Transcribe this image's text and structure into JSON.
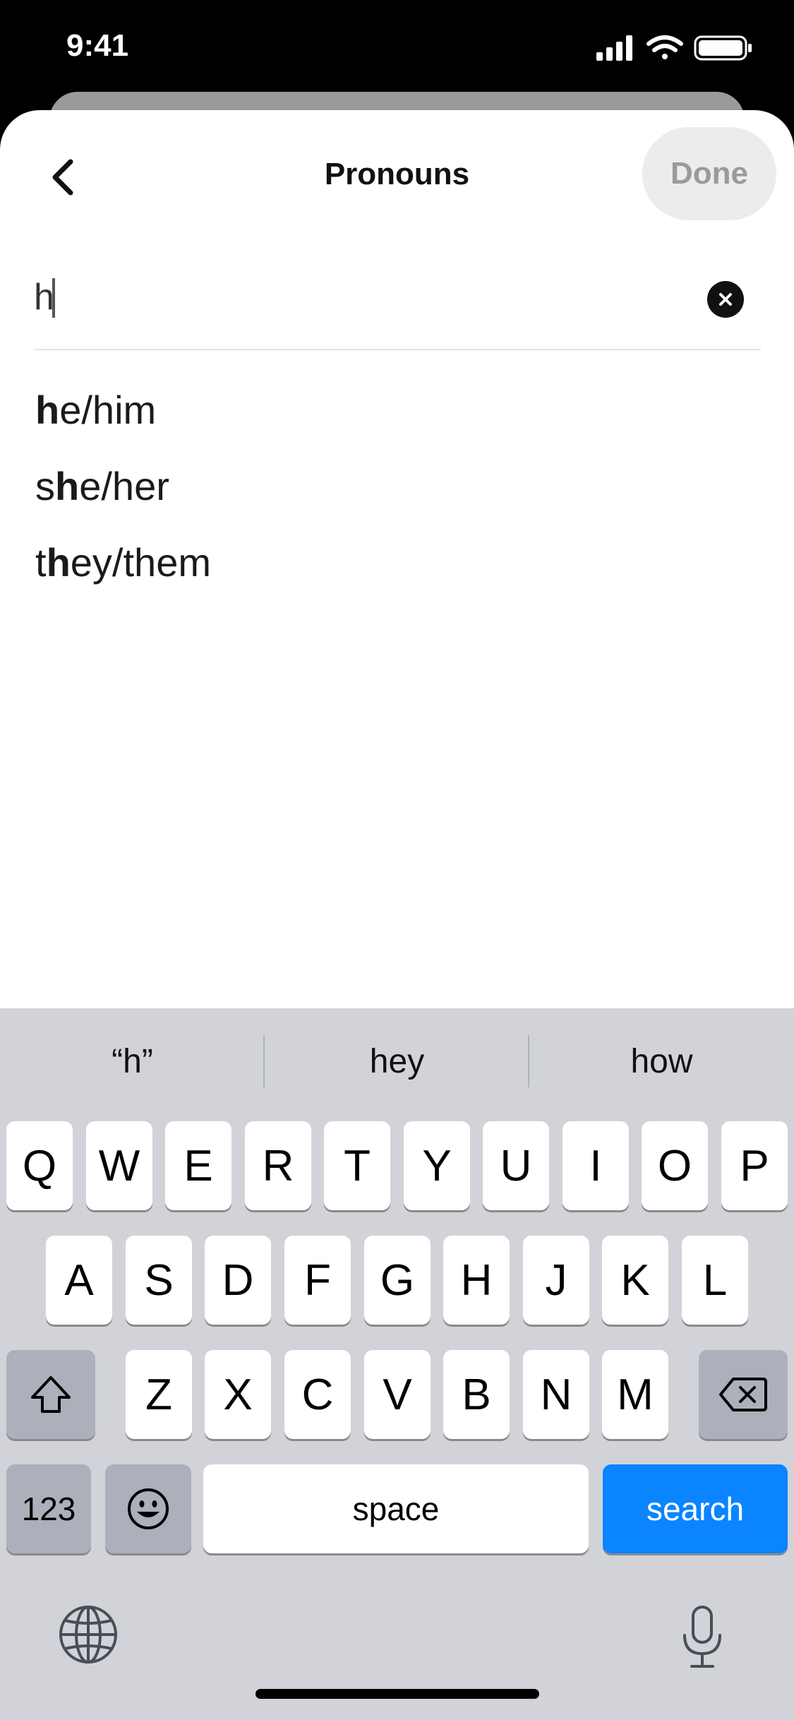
{
  "status_bar": {
    "time": "9:41"
  },
  "nav": {
    "title": "Pronouns",
    "done_label": "Done"
  },
  "search": {
    "value": "h"
  },
  "suggestions": [
    {
      "bold": "h",
      "rest": "e/him",
      "prefix": ""
    },
    {
      "prefix": "s",
      "bold": "h",
      "rest": "e/her"
    },
    {
      "prefix": "t",
      "bold": "h",
      "rest": "ey/them"
    }
  ],
  "keyboard": {
    "predictions": [
      "“h”",
      "hey",
      "how"
    ],
    "row1": [
      "Q",
      "W",
      "E",
      "R",
      "T",
      "Y",
      "U",
      "I",
      "O",
      "P"
    ],
    "row2": [
      "A",
      "S",
      "D",
      "F",
      "G",
      "H",
      "J",
      "K",
      "L"
    ],
    "row3": [
      "Z",
      "X",
      "C",
      "V",
      "B",
      "N",
      "M"
    ],
    "numbers_label": "123",
    "space_label": "space",
    "search_label": "search"
  },
  "colors": {
    "accent": "#0a84ff",
    "keyboard_bg": "#d1d3d9",
    "key_gray": "#abb0ba"
  },
  "icons": [
    "back-chevron-icon",
    "clear-icon",
    "shift-icon",
    "delete-icon",
    "emoji-icon",
    "globe-icon",
    "microphone-icon",
    "signal-icon",
    "wifi-icon",
    "battery-icon"
  ]
}
